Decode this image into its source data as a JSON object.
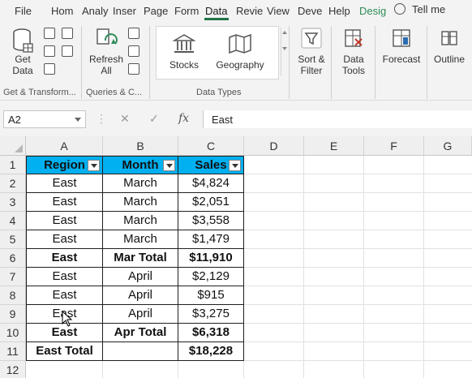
{
  "tabs": [
    "File",
    "Hom",
    "Analy",
    "Inser",
    "Page",
    "Form",
    "Data",
    "Revie",
    "View",
    "Deve",
    "Help",
    "Desig"
  ],
  "active_tab": "Data",
  "tell_me": "Tell me",
  "ribbon": {
    "get_data": "Get Data",
    "get_data_caret": "▾",
    "group_get_transform": "Get & Transform...",
    "refresh_all": "Refresh All",
    "group_queries": "Queries & C...",
    "stocks": "Stocks",
    "geography": "Geography",
    "group_data_types": "Data Types",
    "sort_filter": "Sort & Filter",
    "data_tools": "Data Tools",
    "forecast": "Forecast",
    "outline": "Outline"
  },
  "formula_bar": {
    "name_box": "A2",
    "fx": "fx",
    "value": "East"
  },
  "columns": [
    "A",
    "B",
    "C",
    "D",
    "E",
    "F",
    "G"
  ],
  "rows": [
    "1",
    "2",
    "3",
    "4",
    "5",
    "6",
    "7",
    "8",
    "9",
    "10",
    "11",
    "12"
  ],
  "table": {
    "headers": [
      "Region",
      "Month",
      "Sales"
    ],
    "body": [
      [
        "East",
        "March",
        "$4,824"
      ],
      [
        "East",
        "March",
        "$2,051"
      ],
      [
        "East",
        "March",
        "$3,558"
      ],
      [
        "East",
        "March",
        "$1,479"
      ],
      [
        "East",
        "Mar Total",
        "$11,910"
      ],
      [
        "East",
        "April",
        "$2,129"
      ],
      [
        "East",
        "April",
        "$915"
      ],
      [
        "East",
        "April",
        "$3,275"
      ],
      [
        "East",
        "Apr Total",
        "$6,318"
      ],
      [
        "East Total",
        "",
        "$18,228"
      ]
    ],
    "bold_rows": [
      4,
      8,
      9
    ]
  },
  "colors": {
    "header_fill": "#00b0f0",
    "accent": "#217346"
  }
}
